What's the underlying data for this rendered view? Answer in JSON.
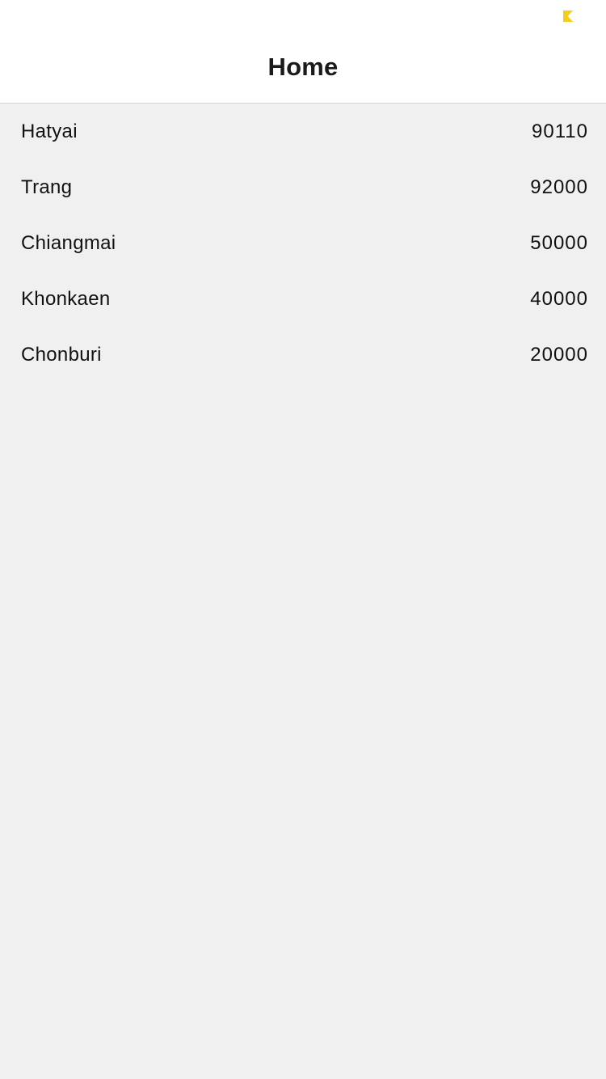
{
  "header": {
    "title": "Home",
    "status_icon": "app-badge-icon",
    "status_color": "#f5cc16"
  },
  "list": {
    "items": [
      {
        "name": "Hatyai",
        "value": "90110"
      },
      {
        "name": "Trang",
        "value": "92000"
      },
      {
        "name": "Chiangmai",
        "value": "50000"
      },
      {
        "name": "Khonkaen",
        "value": "40000"
      },
      {
        "name": "Chonburi",
        "value": "20000"
      }
    ]
  }
}
